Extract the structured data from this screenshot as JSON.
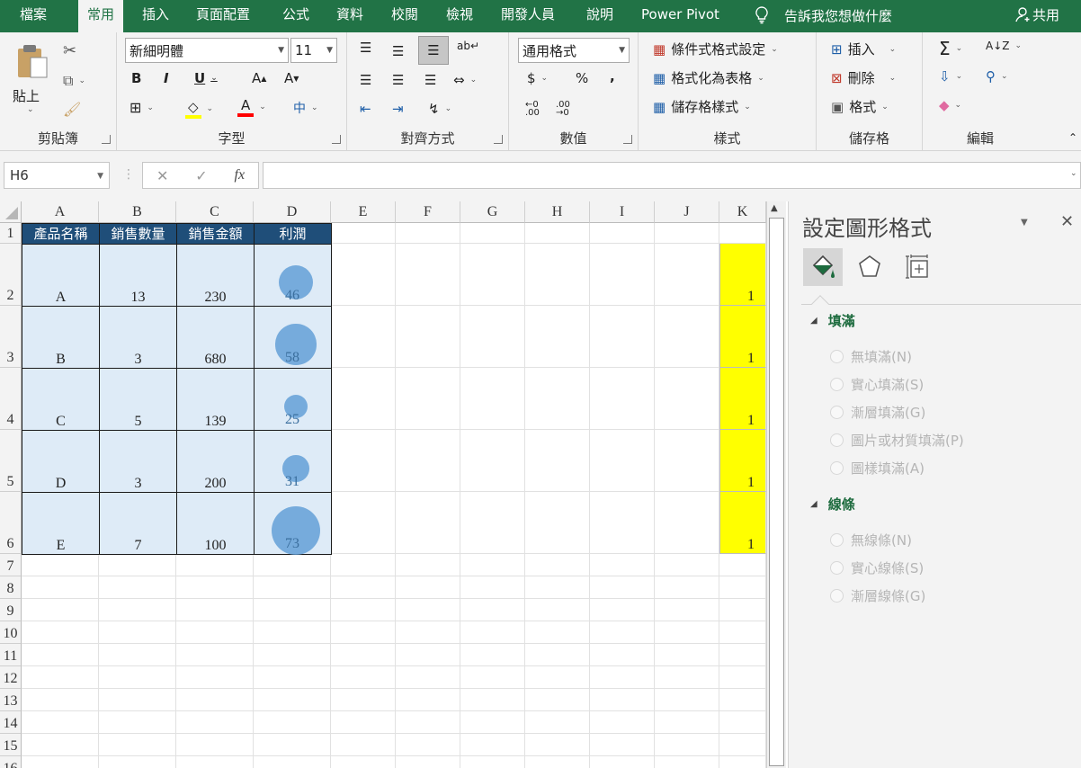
{
  "tabs": [
    {
      "label": "檔案"
    },
    {
      "label": "常用"
    },
    {
      "label": "插入"
    },
    {
      "label": "頁面配置"
    },
    {
      "label": "公式"
    },
    {
      "label": "資料"
    },
    {
      "label": "校閱"
    },
    {
      "label": "檢視"
    },
    {
      "label": "開發人員"
    },
    {
      "label": "說明"
    },
    {
      "label": "Power Pivot"
    }
  ],
  "tell_me": "告訴我您想做什麼",
  "share": "共用",
  "ribbon": {
    "clipboard": {
      "paste": "貼上",
      "label": "剪貼簿"
    },
    "font": {
      "name": "新細明體",
      "size": "11",
      "label": "字型"
    },
    "alignment": {
      "label": "對齊方式"
    },
    "number": {
      "format": "通用格式",
      "currency": "$",
      "percent": "%",
      "comma": ",",
      "label": "數值"
    },
    "styles": {
      "conditional": "條件式格式設定",
      "as_table": "格式化為表格",
      "cell_styles": "儲存格樣式",
      "label": "樣式"
    },
    "cells": {
      "insert": "插入",
      "delete": "刪除",
      "format": "格式",
      "label": "儲存格"
    },
    "editing": {
      "label": "編輯"
    }
  },
  "formula_bar": {
    "name_box": "H6",
    "formula": ""
  },
  "columns": [
    "A",
    "B",
    "C",
    "D",
    "E",
    "F",
    "G",
    "H",
    "I",
    "J",
    "K"
  ],
  "rows": [
    "1",
    "2",
    "3",
    "4",
    "5",
    "6",
    "7",
    "8",
    "9",
    "10",
    "11",
    "12",
    "13",
    "14",
    "15",
    "16"
  ],
  "table": {
    "headers": [
      "產品名稱",
      "銷售數量",
      "銷售金額",
      "利潤"
    ],
    "rows": [
      {
        "name": "A",
        "qty": "13",
        "amount": "230",
        "profit": "46"
      },
      {
        "name": "B",
        "qty": "3",
        "amount": "680",
        "profit": "58"
      },
      {
        "name": "C",
        "qty": "5",
        "amount": "139",
        "profit": "25"
      },
      {
        "name": "D",
        "qty": "3",
        "amount": "200",
        "profit": "31"
      },
      {
        "name": "E",
        "qty": "7",
        "amount": "100",
        "profit": "73"
      }
    ]
  },
  "column_k": [
    "1",
    "1",
    "1",
    "1",
    "1"
  ],
  "pane": {
    "title": "設定圖形格式",
    "fill_section": "填滿",
    "fill_options": [
      "無填滿(N)",
      "實心填滿(S)",
      "漸層填滿(G)",
      "圖片或材質填滿(P)",
      "圖樣填滿(A)"
    ],
    "line_section": "線條",
    "line_options": [
      "無線條(N)",
      "實心線條(S)",
      "漸層線條(G)"
    ]
  },
  "colors": {
    "excel_green": "#217346",
    "header_blue": "#1f4e79",
    "table_fill": "#deebf7",
    "bubble": "#5b9bd5",
    "highlight": "#ffff00"
  }
}
